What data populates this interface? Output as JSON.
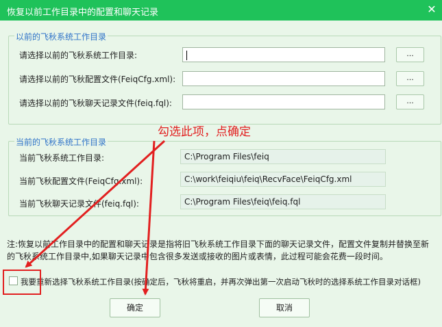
{
  "title": "恢复以前工作目录中的配置和聊天记录",
  "close_glyph": "✕",
  "previous_group": {
    "legend": "以前的飞秋系统工作目录",
    "rows": [
      {
        "label": "请选择以前的飞秋系统工作目录:",
        "value": "",
        "button": "..."
      },
      {
        "label": "请选择以前的飞秋配置文件(FeiqCfg.xml):",
        "value": "",
        "button": "..."
      },
      {
        "label": "请选择以前的飞秋聊天记录文件(feiq.fql):",
        "value": "",
        "button": "..."
      }
    ]
  },
  "current_group": {
    "legend": "当前的飞秋系统工作目录",
    "rows": [
      {
        "label": "当前飞秋系统工作目录:",
        "value": "C:\\Program Files\\feiq"
      },
      {
        "label": "当前飞秋配置文件(FeiqCfg.xml):",
        "value": "C:\\work\\feiqiu\\feiq\\RecvFace\\FeiqCfg.xml"
      },
      {
        "label": "当前飞秋聊天记录文件(feiq.fql):",
        "value": "C:\\Program Files\\feiq\\feiq.fql"
      }
    ]
  },
  "note": "注:恢复以前工作目录中的配置和聊天记录是指将旧飞秋系统工作目录下面的聊天记录文件，配置文件复制并替换至新的飞秋系统工作目录中,如果聊天记录中包含很多发送或接收的图片或表情，此过程可能会花费一段时间。",
  "checkbox": {
    "label": "我要重新选择飞秋系统工作目录(按确定后，飞秋将重启，并再次弹出第一次启动飞秋时的选择系统工作目录对话框)",
    "checked": false
  },
  "buttons": {
    "ok": "确定",
    "cancel": "取消"
  },
  "annotation": {
    "text": "勾选此项，点确定",
    "color": "#e21f1f"
  },
  "colors": {
    "titlebar": "#1fc25a",
    "background": "#e9f6e9",
    "legend": "#2f73c8"
  }
}
